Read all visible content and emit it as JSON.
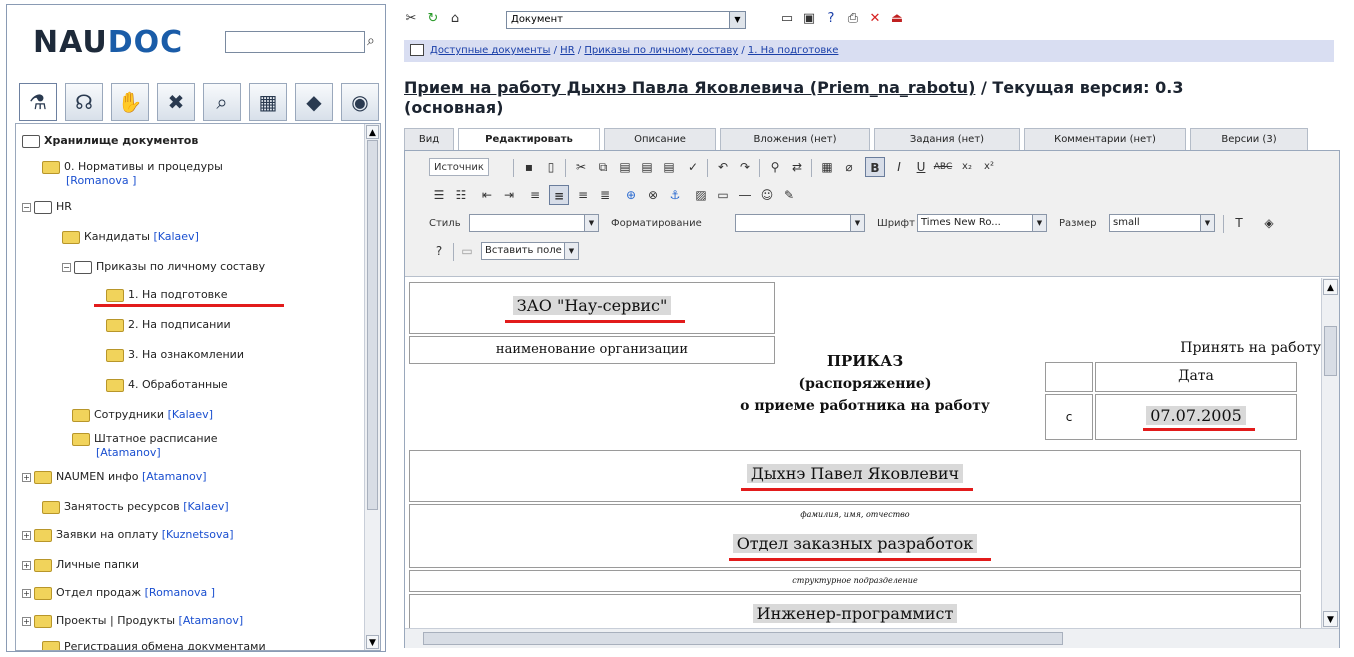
{
  "app": {
    "logo_main": "NAU",
    "logo_accent": "DOC",
    "search_placeholder": ""
  },
  "left_toolbar": {
    "icons": [
      "tree-icon",
      "structure-icon",
      "hand-icon",
      "tools-icon",
      "search-icon",
      "notes-icon",
      "archive-icon",
      "camera-icon"
    ]
  },
  "tree": {
    "root": "Хранилище документов",
    "items": [
      {
        "label": "0. Нормативы и процедуры",
        "owner": "[Romanova ]"
      },
      {
        "label": "HR",
        "owner": ""
      },
      {
        "label": "Кандидаты",
        "owner": "[Kalaev]"
      },
      {
        "label": "Приказы по личному составу",
        "owner": ""
      },
      {
        "label": "1. На подготовке",
        "owner": ""
      },
      {
        "label": "2. На подписании",
        "owner": ""
      },
      {
        "label": "3. На ознакомлении",
        "owner": ""
      },
      {
        "label": "4. Обработанные",
        "owner": ""
      },
      {
        "label": "Сотрудники",
        "owner": "[Kalaev]"
      },
      {
        "label": "Штатное расписание",
        "owner": "[Atamanov]"
      },
      {
        "label": "NAUMEN инфо",
        "owner": "[Atamanov]"
      },
      {
        "label": "Занятость ресурсов",
        "owner": "[Kalaev]"
      },
      {
        "label": "Заявки на оплату",
        "owner": "[Kuznetsova]"
      },
      {
        "label": "Личные папки",
        "owner": ""
      },
      {
        "label": "Отдел продаж",
        "owner": "[Romanova ]"
      },
      {
        "label": "Проекты | Продукты",
        "owner": "[Atamanov]"
      },
      {
        "label": "Регистрация обмена документами",
        "owner": ""
      }
    ]
  },
  "top_toolbar": {
    "select_value": "Документ"
  },
  "breadcrumb": [
    "Доступные документы",
    "HR",
    "Приказы по личному составу",
    "1. На подготовке"
  ],
  "title": {
    "link": "Прием на работу Дыхнэ Павла Яковлевича (Priem_na_rabotu)",
    "rest": " / Текущая версия: 0.3",
    "line2": "(основная)"
  },
  "tabs": [
    "Вид",
    "Редактировать",
    "Описание",
    "Вложения (нет)",
    "Задания (нет)",
    "Комментарии (нет)",
    "Версии (3)"
  ],
  "editor": {
    "source_button": "Источник",
    "style_label": "Стиль",
    "style_value": "",
    "format_label": "Форматирование",
    "format_value": "",
    "font_label": "Шрифт",
    "font_value": "Times New Ro...",
    "size_label": "Размер",
    "size_value": "small",
    "insert_field": "Вставить поле"
  },
  "document": {
    "org_name": "ЗАО \"Нау-сервис\"",
    "org_caption": "наименование организации",
    "order_title": "ПРИКАЗ",
    "order_sub": "(распоряжение)",
    "order_sub2": "о приеме работника на работу",
    "hire_label": "Принять на работу",
    "date_header": "Дата",
    "from_label": "с",
    "date_value": "07.07.2005",
    "employee_name": "Дыхнэ Павел Яковлевич",
    "name_caption": "фамилия, имя, отчество",
    "department": "Отдел заказных разработок",
    "dept_caption": "структурное подразделение",
    "position": "Инженер-программист"
  },
  "colors": {
    "highlight_underline": "#e21b1b",
    "breadcrumb_bg": "#d9def2",
    "owner_link": "#1a4fd0"
  }
}
